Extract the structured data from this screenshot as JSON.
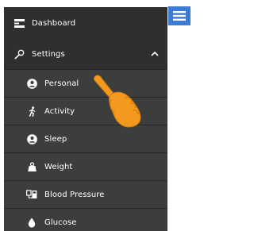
{
  "menu": {
    "dashboard_label": "Dashboard",
    "settings_label": "Settings",
    "settings_expanded": true,
    "submenu": [
      {
        "label": "Personal",
        "icon": "person-icon"
      },
      {
        "label": "Activity",
        "icon": "running-person-icon"
      },
      {
        "label": "Sleep",
        "icon": "sleep-person-icon"
      },
      {
        "label": "Weight",
        "icon": "scale-weight-icon"
      },
      {
        "label": "Blood Pressure",
        "icon": "blood-pressure-monitor-icon"
      },
      {
        "label": "Glucose",
        "icon": "drop-icon"
      }
    ]
  },
  "colors": {
    "drawer_bg": "#2e2f2f",
    "submenu_bg": "#3c3d3d",
    "hamburger_bg": "#3d7bd4",
    "pointer_hand": "#f39a1e"
  }
}
